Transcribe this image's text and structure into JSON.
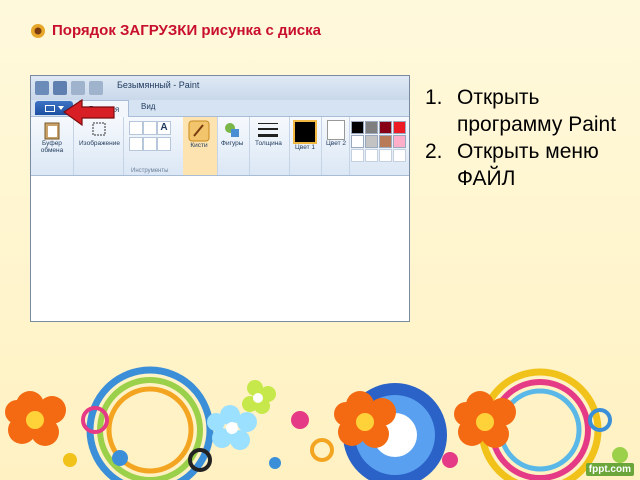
{
  "slide": {
    "title": "Порядок ЗАГРУЗКИ рисунка с диска",
    "title_icon": "flower-bullet-icon",
    "accent_color": "#c8102e",
    "steps": [
      {
        "num": "1.",
        "text": "Открыть программу Paint"
      },
      {
        "num": "2.",
        "text": "Открыть меню ФАЙЛ"
      }
    ],
    "watermark": "fppt.com"
  },
  "paint": {
    "window_title": "Безымянный - Paint",
    "tabs": {
      "file_icon": "file-menu-icon",
      "home": "Главная",
      "view": "Вид"
    },
    "ribbon": {
      "clipboard": "Буфер обмена",
      "image": "Изображение",
      "tools_caption": "Инструменты",
      "brushes": "Кисти",
      "shapes": "Фигуры",
      "size": "Толщина",
      "color1": "Цвет 1",
      "color2": "Цвет 2"
    },
    "palette": [
      "#000000",
      "#7f7f7f",
      "#880015",
      "#ed1c24",
      "#ffffff",
      "#c3c3c3",
      "#b97a57",
      "#ffaec9"
    ]
  }
}
